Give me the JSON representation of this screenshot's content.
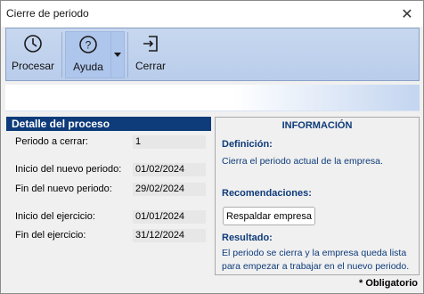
{
  "window": {
    "title": "Cierre de periodo"
  },
  "toolbar": {
    "procesar_label": "Procesar",
    "ayuda_label": "Ayuda",
    "cerrar_label": "Cerrar"
  },
  "detail": {
    "header": "Detalle del proceso",
    "fields": [
      {
        "label": "Periodo a cerrar:",
        "value": "1"
      },
      {
        "label": "Inicio del nuevo periodo:",
        "value": "01/02/2024"
      },
      {
        "label": "Fin del nuevo periodo:",
        "value": "29/02/2024"
      },
      {
        "label": "Inicio del ejercicio:",
        "value": "01/01/2024"
      },
      {
        "label": "Fin del ejercicio:",
        "value": "31/12/2024"
      }
    ]
  },
  "info": {
    "title": "INFORMACIÓN",
    "definicion_h": "Definición:",
    "definicion_t": "Cierra el periodo actual de la empresa.",
    "recomendaciones_h": "Recomendaciones:",
    "respaldar_label": "Respaldar empresa",
    "resultado_h": "Resultado:",
    "resultado_t": "El periodo se cierra y la empresa queda lista para empezar a trabajar en el nuevo periodo."
  },
  "footer": {
    "obligatorio": "* Obligatorio"
  },
  "colors": {
    "accent": "#0e3b7a",
    "toolbar": "#b9cdeb"
  }
}
